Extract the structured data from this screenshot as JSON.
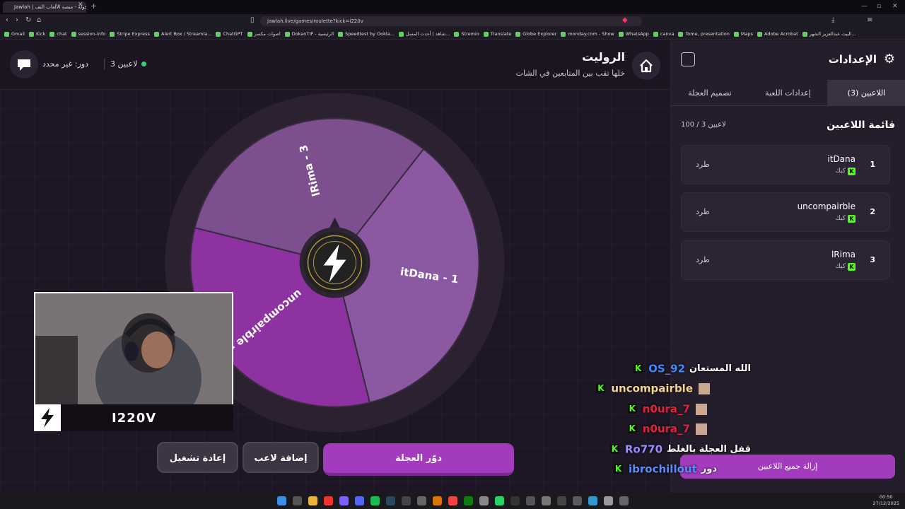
{
  "browser": {
    "tab_title": "Jawlah | جولة - منصة الألعاب التف...",
    "url": "jawlah.live/games/roulette?kick=i220v",
    "bookmarks": [
      "Gmail",
      "Kick",
      "chat",
      "session-info",
      "Stripe Express",
      "Alert Box / Streamla...",
      "ChatGPT",
      "اصوات مكسر",
      "DokanTIP - الرئيسية",
      "Speedtest by Ookla...",
      "شاهد | أحدث المسل...",
      "Stremio",
      "Translate",
      "Globe Explorer",
      "monday.com - Show",
      "WhatsApp",
      "canva",
      "Tome, presentation",
      "Maps",
      "Adobe Acrobat",
      "البيت عبدالعزيز الشهر..."
    ]
  },
  "header": {
    "title": "الروليت",
    "subtitle": "خلها تقب بين المتابعين في الشات",
    "role": "دور: غير محدد",
    "players": "3 لاعبين"
  },
  "wheel": {
    "segments": [
      {
        "label": "itDana - 1",
        "color": "#8c58a2"
      },
      {
        "label": "uncompairble - 2",
        "color": "#8d32a0"
      },
      {
        "label": "lRima - 3",
        "color": "#7d4f8f"
      }
    ]
  },
  "webcam": {
    "streamer": "I220V"
  },
  "buttons": {
    "restart": "إعادة تشغيل",
    "add_player": "إضافة لاعب",
    "spin": "دوّر العجلة",
    "remove_all": "إزالة جميع اللاعبين"
  },
  "panel": {
    "title": "الإعدادات",
    "tabs": [
      "اللاعبين (3)",
      "إعدادات اللعبة",
      "تصميم العجلة"
    ],
    "list_title": "قائمة اللاعبين",
    "list_count": "100 / 3 لاعبين",
    "players": [
      {
        "index": "1",
        "name": "itDana",
        "platform": "كيك",
        "kick": "طرد"
      },
      {
        "index": "2",
        "name": "uncompairble",
        "platform": "كيك",
        "kick": "طرد"
      },
      {
        "index": "3",
        "name": "lRima",
        "platform": "كيك",
        "kick": "طرد"
      }
    ]
  },
  "chat": [
    {
      "user": "OS_92",
      "color": "#3d8bff",
      "msg": "الله المستعان",
      "badge": false
    },
    {
      "user": "uncompairble",
      "color": "#f4d58d",
      "msg": "",
      "badge": true
    },
    {
      "user": "n0ura_7",
      "color": "#e0243c",
      "msg": "",
      "badge": true
    },
    {
      "user": "n0ura_7",
      "color": "#e0243c",
      "msg": "",
      "badge": true
    },
    {
      "user": "Ro770",
      "color": "#9b8cff",
      "msg": "قفل العجلة بالغلط",
      "badge": false
    },
    {
      "user": "ibrochillout",
      "color": "#5b8bff",
      "msg": "دور",
      "badge": false
    }
  ],
  "clock": {
    "time": "00:50",
    "date": "27/12/2025"
  }
}
